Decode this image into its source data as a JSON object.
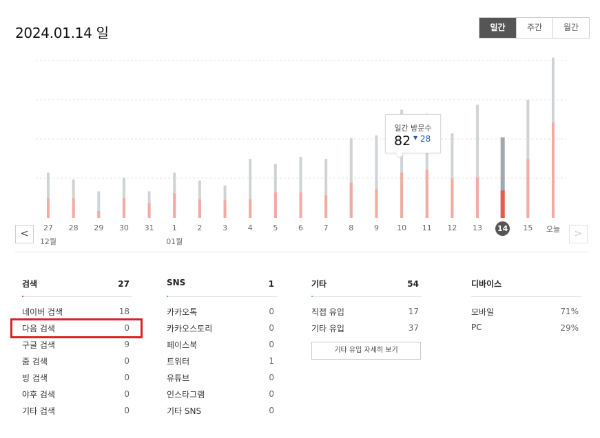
{
  "header": {
    "date_title": "2024.01.14 일"
  },
  "period_tabs": [
    {
      "label": "일간",
      "active": true
    },
    {
      "label": "주간",
      "active": false
    },
    {
      "label": "월간",
      "active": false
    }
  ],
  "nav": {
    "prev_icon": "chevron-left-icon",
    "next_icon": "chevron-right-icon",
    "prev_glyph": "<",
    "next_glyph": ">"
  },
  "colors": {
    "total_bar": "#cfd3d5",
    "visitor_bar": "#f2aba1",
    "selected_total": "#a1a8ae",
    "selected_visitor": "#e95a4e",
    "gridline": "#e3e3e3"
  },
  "chart_data": {
    "type": "bar",
    "categories": [
      "27",
      "28",
      "29",
      "30",
      "31",
      "1",
      "2",
      "3",
      "4",
      "5",
      "6",
      "7",
      "8",
      "9",
      "10",
      "11",
      "12",
      "13",
      "14",
      "15",
      "오늘"
    ],
    "month_labels": [
      {
        "index": 0,
        "label": "12월"
      },
      {
        "index": 5,
        "label": "01월"
      }
    ],
    "selected_index": 18,
    "series": [
      {
        "values": [
          46,
          39,
          27,
          41,
          27,
          46,
          38,
          33,
          60,
          55,
          62,
          60,
          81,
          84,
          110,
          106,
          86,
          115,
          82,
          120,
          163
        ]
      },
      {
        "values": [
          20,
          20,
          7,
          20,
          15,
          25,
          19,
          18,
          19,
          26,
          26,
          23,
          36,
          29,
          46,
          49,
          40,
          41,
          28,
          60,
          97
        ]
      }
    ],
    "ylim": [
      0,
      160
    ],
    "grid": true
  },
  "tooltip": {
    "label": "일간 방문수",
    "value": "82",
    "arrow": "▼",
    "delta": "28"
  },
  "panels": {
    "search": {
      "title": "검색",
      "count": "27",
      "accent": "#e95a4e",
      "rows": [
        {
          "label": "네이버 검색",
          "value": "18"
        },
        {
          "label": "다음 검색",
          "value": "0"
        },
        {
          "label": "구글 검색",
          "value": "9"
        },
        {
          "label": "줌 검색",
          "value": "0"
        },
        {
          "label": "빙 검색",
          "value": "0"
        },
        {
          "label": "야후 검색",
          "value": "0"
        },
        {
          "label": "기타 검색",
          "value": "0"
        }
      ]
    },
    "sns": {
      "title": "SNS",
      "count": "1",
      "accent": "#3fb8b0",
      "rows": [
        {
          "label": "카카오톡",
          "value": "0"
        },
        {
          "label": "카카오스토리",
          "value": "0"
        },
        {
          "label": "페이스북",
          "value": "0"
        },
        {
          "label": "트위터",
          "value": "1"
        },
        {
          "label": "유튜브",
          "value": "0"
        },
        {
          "label": "인스타그램",
          "value": "0"
        },
        {
          "label": "기타 SNS",
          "value": "0"
        }
      ]
    },
    "etc": {
      "title": "기타",
      "count": "54",
      "accent": "#7ac0a8",
      "rows": [
        {
          "label": "직접 유입",
          "value": "17"
        },
        {
          "label": "기타 유입",
          "value": "37"
        }
      ],
      "detail_button": "기타 유입 자세히 보기"
    },
    "device": {
      "title": "디바이스",
      "count": "",
      "accent": "",
      "rows": [
        {
          "label": "모바일",
          "value": "71%"
        },
        {
          "label": "PC",
          "value": "29%"
        }
      ]
    }
  }
}
